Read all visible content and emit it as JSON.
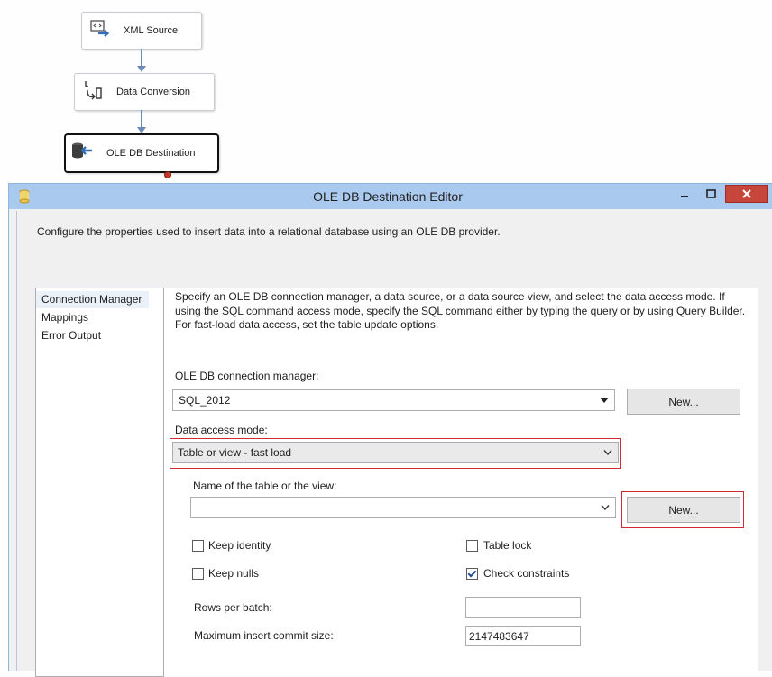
{
  "canvas": {
    "nodes": [
      {
        "label": "XML Source",
        "icon": "xml-source-icon"
      },
      {
        "label": "Data Conversion",
        "icon": "data-conversion-icon"
      },
      {
        "label": "OLE DB Destination",
        "icon": "ole-db-destination-icon"
      }
    ]
  },
  "dialog": {
    "title": "OLE DB Destination Editor",
    "instruction": "Configure the properties used to insert data into a relational database using an OLE DB provider.",
    "nav": [
      "Connection Manager",
      "Mappings",
      "Error Output"
    ],
    "description": "Specify an OLE DB connection manager, a data source, or a data source view, and select the data access mode. If using the SQL command access mode, specify the SQL command either by typing the query or by using Query Builder. For fast-load data access, set the table update options.",
    "connection_manager": {
      "label": "OLE DB connection manager:",
      "value": "SQL_2012",
      "new_button": "New..."
    },
    "data_access_mode": {
      "label": "Data access mode:",
      "value": "Table or view - fast load"
    },
    "table_name": {
      "label": "Name of the table or the view:",
      "value": "",
      "new_button": "New..."
    },
    "options": {
      "keep_identity": {
        "label": "Keep identity",
        "checked": false
      },
      "table_lock": {
        "label": "Table lock",
        "checked": false
      },
      "keep_nulls": {
        "label": "Keep nulls",
        "checked": false
      },
      "check_constraints": {
        "label": "Check constraints",
        "checked": true
      }
    },
    "rows_per_batch": {
      "label": "Rows per batch:",
      "value": ""
    },
    "max_insert_commit": {
      "label": "Maximum insert commit size:",
      "value": "2147483647"
    },
    "colors": {
      "titlebar": "#a9c9ee",
      "close": "#c7463c",
      "highlight": "#d02a33",
      "arrow": "#6a8cb8"
    }
  }
}
